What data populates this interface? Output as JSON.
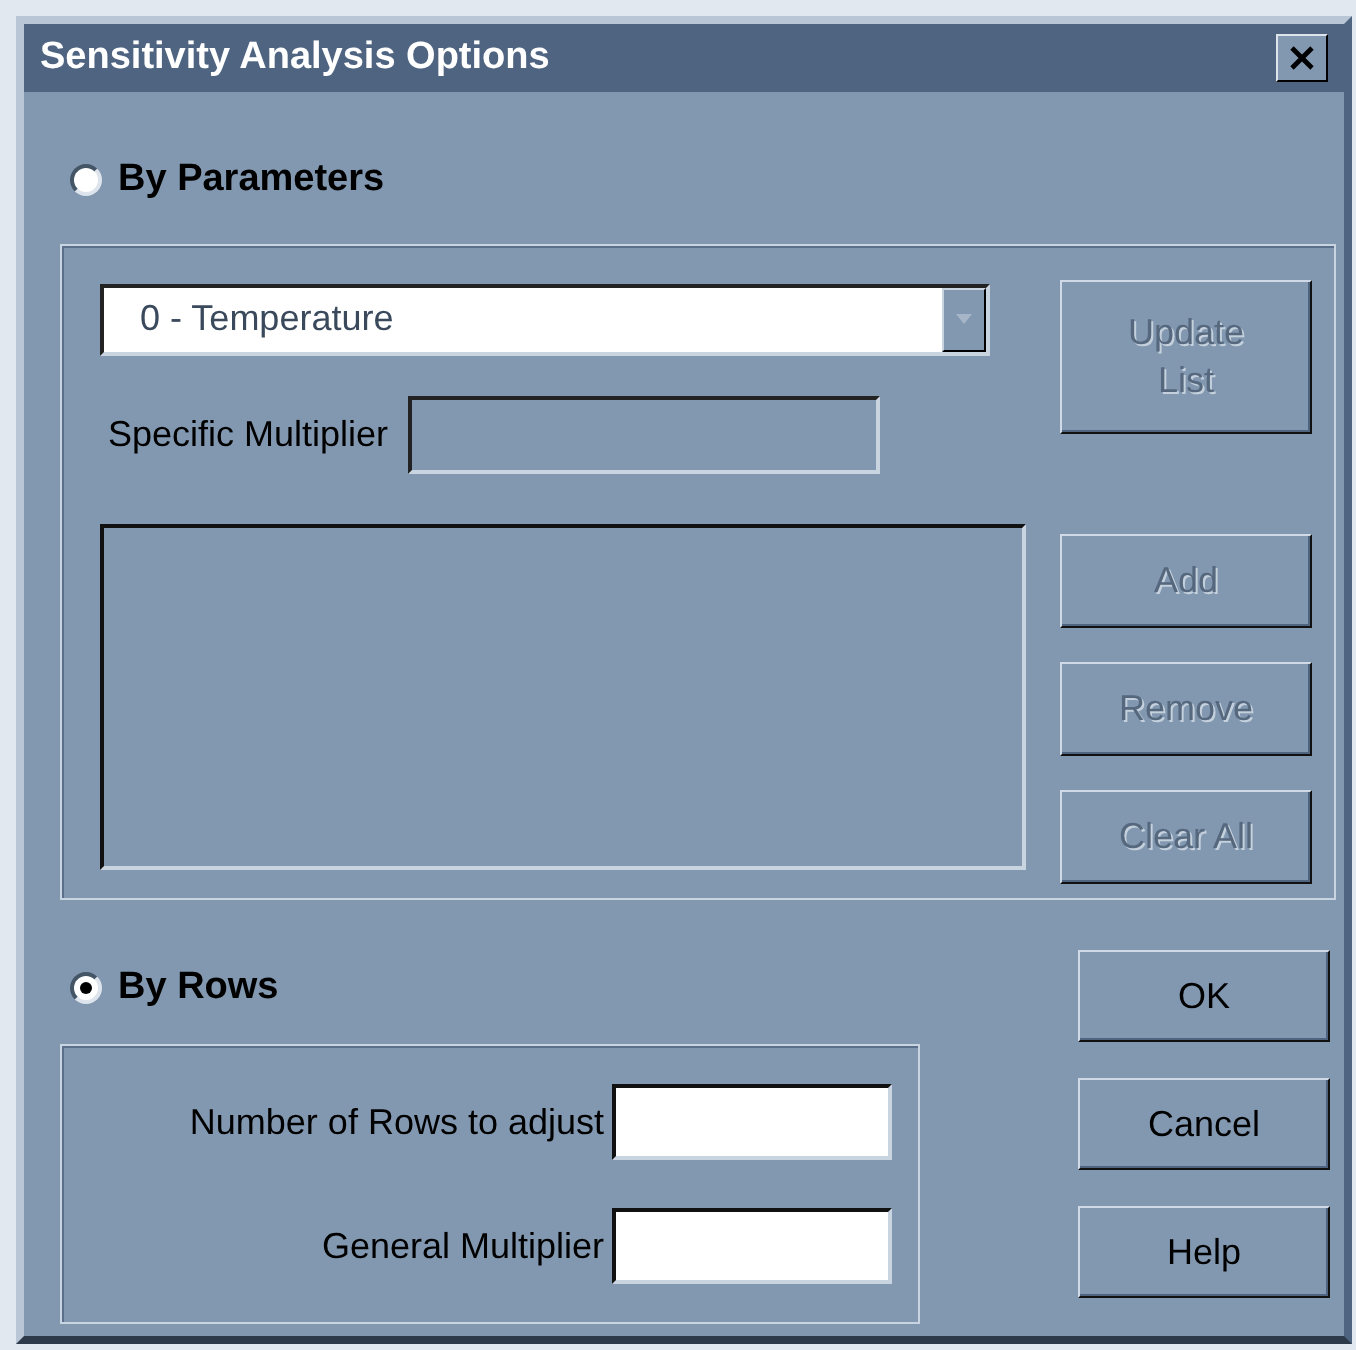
{
  "window": {
    "title": "Sensitivity Analysis Options"
  },
  "modes": [
    {
      "label": "By Parameters",
      "selected": false
    },
    {
      "label": "By Rows",
      "selected": true
    }
  ],
  "by_parameters": {
    "parameter": {
      "value": "0 - Temperature"
    },
    "specific_multiplier": {
      "label": "Specific Multiplier",
      "disabled": true
    },
    "buttons": [
      {
        "label": "Update List",
        "disabled": true
      },
      {
        "label": "Add",
        "disabled": true
      },
      {
        "label": "Remove",
        "disabled": true
      },
      {
        "label": "Clear All",
        "disabled": true
      }
    ]
  },
  "by_rows": {
    "fields": [
      {
        "label": "Number of Rows to adjust"
      },
      {
        "label": "General Multiplier"
      }
    ]
  },
  "buttons": [
    {
      "label": "OK",
      "disabled": false
    },
    {
      "label": "Cancel",
      "disabled": false
    },
    {
      "label": "Help",
      "disabled": false
    }
  ]
}
